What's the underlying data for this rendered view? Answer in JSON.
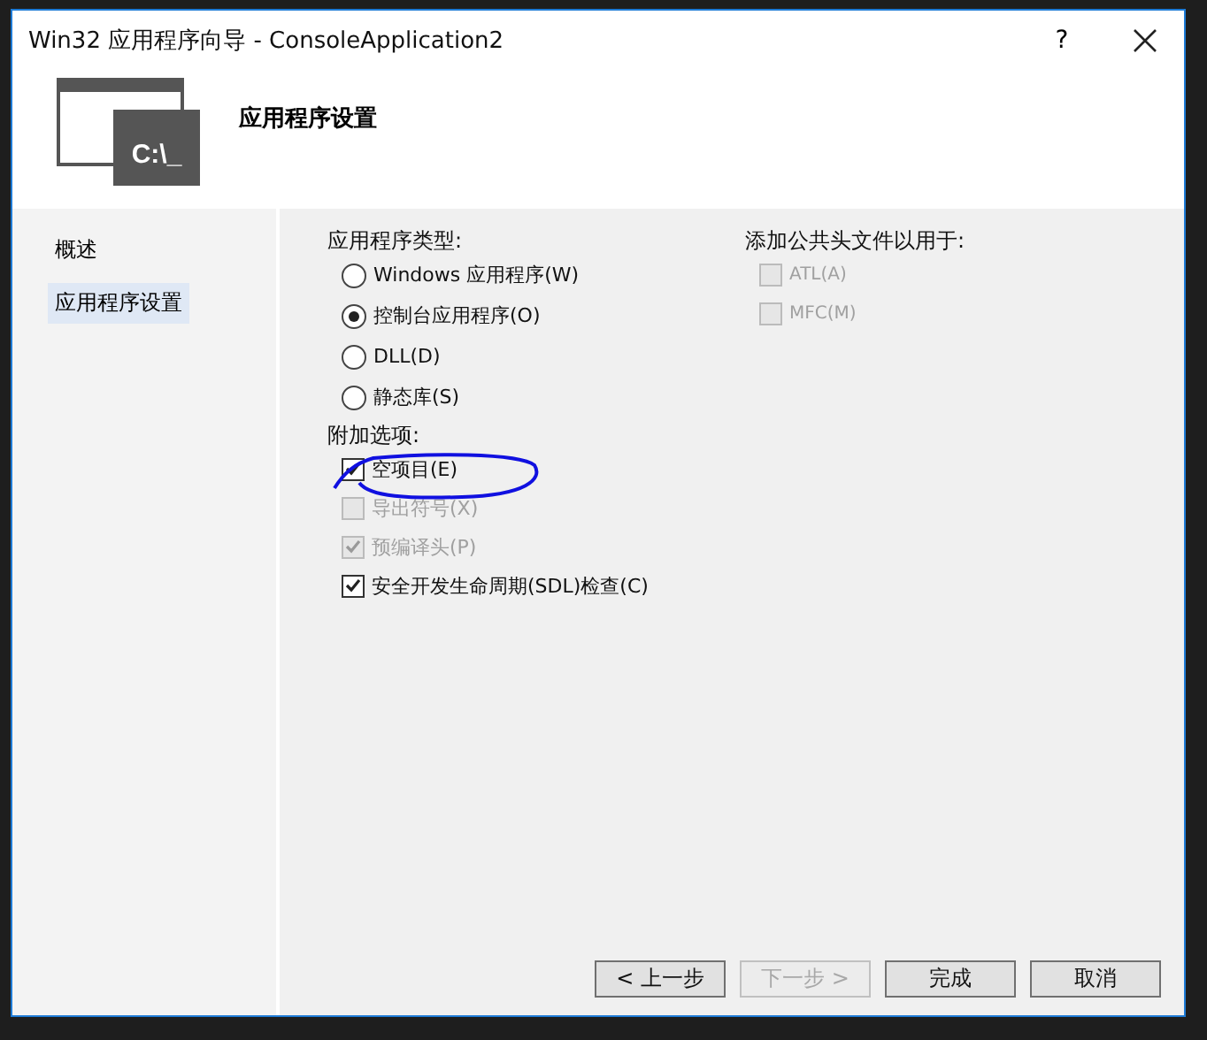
{
  "window": {
    "title": "Win32 应用程序向导 - ConsoleApplication2",
    "help": "?"
  },
  "header": {
    "title": "应用程序设置",
    "icon_text": "C:\\_"
  },
  "sidebar": {
    "items": [
      {
        "label": "概述",
        "selected": false
      },
      {
        "label": "应用程序设置",
        "selected": true
      }
    ]
  },
  "app_type": {
    "label": "应用程序类型:",
    "options": [
      {
        "label": "Windows 应用程序(W)",
        "selected": false
      },
      {
        "label": "控制台应用程序(O)",
        "selected": true
      },
      {
        "label": "DLL(D)",
        "selected": false
      },
      {
        "label": "静态库(S)",
        "selected": false
      }
    ]
  },
  "extra_options": {
    "label": "附加选项:",
    "options": [
      {
        "label": "空项目(E)",
        "checked": true,
        "disabled": false
      },
      {
        "label": "导出符号(X)",
        "checked": false,
        "disabled": true
      },
      {
        "label": "预编译头(P)",
        "checked": true,
        "disabled": true
      },
      {
        "label": "安全开发生命周期(SDL)检查(C)",
        "checked": true,
        "disabled": false
      }
    ]
  },
  "common_headers": {
    "label": "添加公共头文件以用于:",
    "options": [
      {
        "label": "ATL(A)",
        "checked": false,
        "disabled": true
      },
      {
        "label": "MFC(M)",
        "checked": false,
        "disabled": true
      }
    ]
  },
  "buttons": [
    {
      "label": "< 上一步",
      "disabled": false
    },
    {
      "label": "下一步 >",
      "disabled": true
    },
    {
      "label": "完成",
      "disabled": false
    },
    {
      "label": "取消",
      "disabled": false
    }
  ]
}
